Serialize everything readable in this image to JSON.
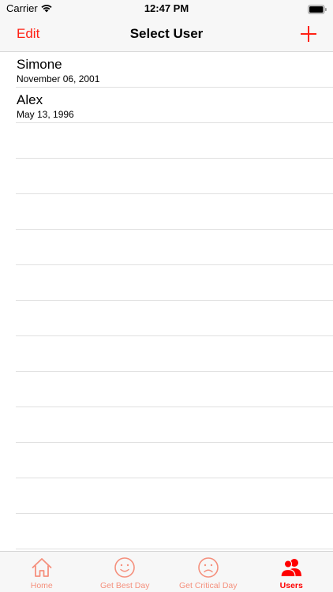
{
  "status_bar": {
    "carrier": "Carrier",
    "time": "12:47 PM"
  },
  "nav": {
    "edit_label": "Edit",
    "title": "Select User",
    "add_icon": "plus-icon"
  },
  "users": [
    {
      "name": "Simone",
      "date": "November 06, 2001"
    },
    {
      "name": "Alex",
      "date": "May 13, 1996"
    }
  ],
  "tabs": [
    {
      "label": "Home",
      "icon": "home-icon",
      "active": false
    },
    {
      "label": "Get Best Day",
      "icon": "smiley-icon",
      "active": false
    },
    {
      "label": "Get Critical Day",
      "icon": "frown-icon",
      "active": false
    },
    {
      "label": "Users",
      "icon": "users-icon",
      "active": true
    }
  ],
  "colors": {
    "accent": "#ff2215",
    "tab_inactive": "#f5907d",
    "bar_background": "#f7f7f7"
  }
}
